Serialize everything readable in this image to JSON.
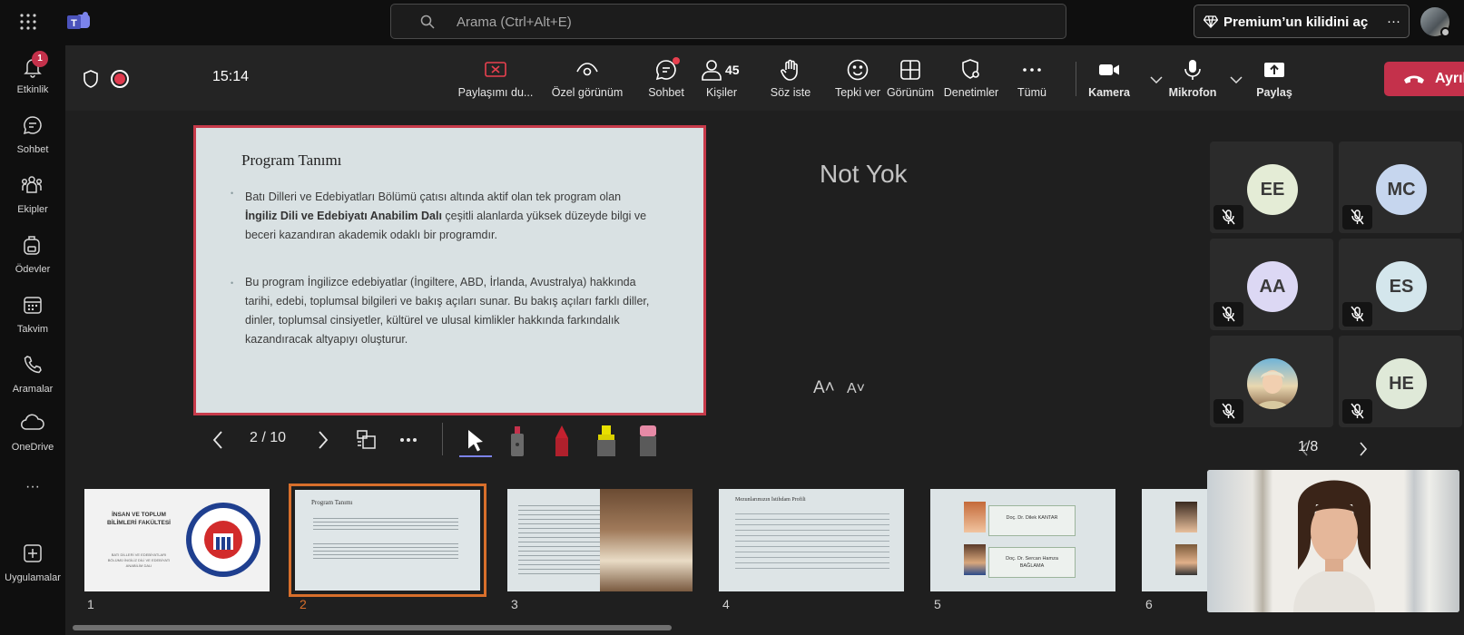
{
  "search": {
    "placeholder": "Arama (Ctrl+Alt+E)"
  },
  "premium": {
    "label": "Premium’un kilidini aç",
    "more": "···"
  },
  "rail": {
    "items": [
      {
        "label": "Etkinlik",
        "icon": "bell-icon",
        "badge": "1"
      },
      {
        "label": "Sohbet",
        "icon": "chat-icon"
      },
      {
        "label": "Ekipler",
        "icon": "teams-icon"
      },
      {
        "label": "Ödevler",
        "icon": "backpack-icon"
      },
      {
        "label": "Takvim",
        "icon": "calendar-icon"
      },
      {
        "label": "Aramalar",
        "icon": "phone-icon"
      },
      {
        "label": "OneDrive",
        "icon": "cloud-icon"
      },
      {
        "label": "···",
        "icon": "more-icon"
      },
      {
        "label": "Uygulamalar",
        "icon": "add-apps-icon"
      }
    ]
  },
  "meeting": {
    "timer": "15:14",
    "tools": {
      "stop_share": "Paylaşımı du...",
      "private_view": "Özel görünüm",
      "chat": "Sohbet",
      "people": "Kişiler",
      "people_count": "45",
      "raise_hand": "Söz iste",
      "react": "Tepki ver",
      "view": "Görünüm",
      "controls": "Denetimler",
      "more": "Tümü",
      "camera": "Kamera",
      "mic": "Mikrofon",
      "share": "Paylaş",
      "leave": "Ayrıl"
    }
  },
  "slide": {
    "title": "Program Tanımı",
    "p1_a": "Batı Dilleri ve Edebiyatları Bölümü çatısı altında aktif olan tek program olan",
    "p1_bold": "İngiliz Dili ve Edebiyatı Anabilim Dalı",
    "p1_b": " çeşitli alanlarda yüksek düzeyde bilgi ve",
    "p1_c": "beceri kazandıran akademik odaklı bir programdır.",
    "p2_a": "Bu program İngilizce edebiyatlar (İngiltere, ABD, İrlanda, Avustralya) hakkında",
    "p2_b": "tarihi, edebi, toplumsal bilgileri ve bakış açıları sunar. Bu bakış açıları farklı diller,",
    "p2_c": "dinler, toplumsal cinsiyetler, kültürel ve ulusal kimlikler hakkında farkındalık",
    "p2_d": "kazandıracak altyapıyı oluşturur."
  },
  "notes": {
    "text": "Not Yok",
    "font_up": "A˄",
    "font_down": "A˅"
  },
  "slide_controls": {
    "page": "2 / 10"
  },
  "participants": {
    "pager": "1/8",
    "tiles": [
      {
        "initials": "EE",
        "color": "#e4ecd6"
      },
      {
        "initials": "MC",
        "color": "#c6d6ee"
      },
      {
        "initials": "AA",
        "color": "#dcd8f4"
      },
      {
        "initials": "ES",
        "color": "#d4e6ec"
      },
      {
        "initials": "",
        "color": "#d9c6a8"
      },
      {
        "initials": "HE",
        "color": "#dfe9d8"
      }
    ]
  },
  "thumbnails": {
    "numbers": [
      "1",
      "2",
      "3",
      "4",
      "5",
      "6"
    ],
    "t1_title": "İNSAN VE TOPLUM BİLİMLERİ FAKÜLTESİ",
    "t1_sub": "BATI DİLLERİ VE EDEBİYATLARI BÖLÜMÜ İNGİLİZ DİLİ VE EDEBİYATI ANABİLİM DALI",
    "t1_seal_year": "1992",
    "t1_seal_text": "ÇANAKKALE ONSEKİZ MART ÜNİVERSİTESİ",
    "t2_title": "Program Tanımı",
    "t4_title": "Mezunlarımızın İstihdam Profili",
    "t5_n1": "Doç. Dr. Dilek KANTAR",
    "t5_n2": "Doç. Dr. Sercan Hamza BAĞLAMA"
  },
  "colors": {
    "accent": "#c4314b",
    "selected_thumb": "#d86f2b",
    "slide_border": "#c73a4a"
  }
}
